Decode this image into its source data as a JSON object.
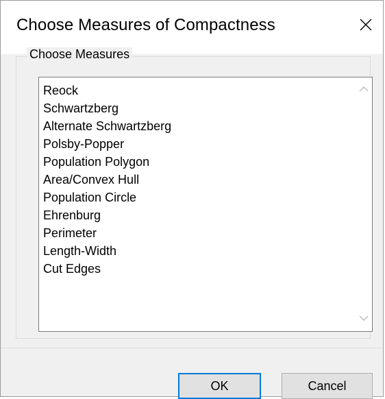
{
  "dialog": {
    "title": "Choose Measures of Compactness",
    "close_icon": "close-icon"
  },
  "group": {
    "label": "Choose Measures"
  },
  "measures": {
    "items": [
      "Reock",
      "Schwartzberg",
      "Alternate Schwartzberg",
      "Polsby-Popper",
      "Population Polygon",
      "Area/Convex Hull",
      "Population Circle",
      "Ehrenburg",
      "Perimeter",
      "Length-Width",
      "Cut Edges"
    ],
    "scroll_up_icon": "chevron-up-icon",
    "scroll_down_icon": "chevron-down-icon"
  },
  "buttons": {
    "ok_label": "OK",
    "cancel_label": "Cancel"
  },
  "colors": {
    "focus_border": "#0078d7",
    "dialog_background": "#f0f0f0",
    "button_face": "#e1e1e1"
  }
}
